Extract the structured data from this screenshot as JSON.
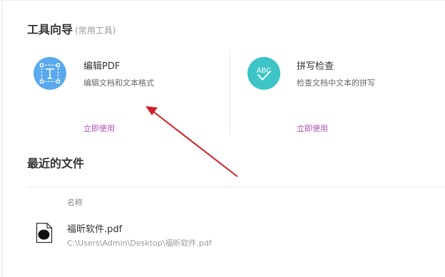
{
  "tools": {
    "title": "工具向导",
    "subtitle": "(常用工具)",
    "cards": [
      {
        "icon": "edit-text-icon",
        "title": "编辑PDF",
        "desc": "编辑文档和文本格式",
        "link": "立即使用",
        "color": "#5aa9ef"
      },
      {
        "icon": "spellcheck-icon",
        "title": "拼写检查",
        "desc": "检查文档中文本的拼写",
        "link": "立即使用",
        "color": "#3cc4c6"
      }
    ]
  },
  "recent": {
    "title": "最近的文件",
    "column_name": "名称",
    "files": [
      {
        "name": "福昕软件.pdf",
        "path": "C:\\Users\\Admin\\Desktop\\福昕软件.pdf"
      }
    ]
  },
  "annotation": {
    "color": "#d0202a"
  }
}
